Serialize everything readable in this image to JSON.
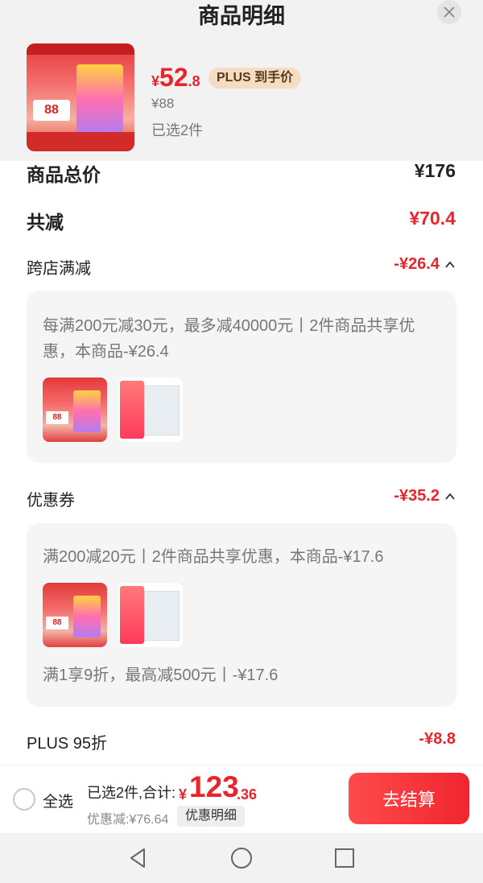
{
  "header": {
    "title": "商品明细"
  },
  "product": {
    "price_symbol": "¥",
    "price_int": "52",
    "price_dec": ".8",
    "plus_badge": "PLUS 到手价",
    "original_price": "¥88",
    "selected_count": "已选2件",
    "thumb_tag": "88"
  },
  "summary_rows": {
    "total_label": "商品总价",
    "total_value": "¥176",
    "reduce_label": "共减",
    "reduce_value": "¥70.4"
  },
  "sections": {
    "cross_store": {
      "label": "跨店满减",
      "value": "-¥26.4",
      "desc": "每满200元减30元，最多减40000元丨2件商品共享优惠，本商品-¥26.4"
    },
    "coupon": {
      "label": "优惠券",
      "value": "-¥35.2",
      "desc1": "满200减20元丨2件商品共享优惠，本商品-¥17.6",
      "desc2": "满1享9折，最高减500元丨-¥17.6"
    },
    "plus": {
      "label": "PLUS 95折",
      "value": "-¥8.8"
    }
  },
  "bottom_bar": {
    "select_all": "全选",
    "summary_text": "已选2件,合计:",
    "total_symbol": "¥",
    "total_int": "123",
    "total_dec": ".36",
    "discount_text": "优惠减:¥76.64",
    "detail_button": "优惠明细",
    "checkout_button": "去结算"
  },
  "colors": {
    "accent_red": "#e8242c",
    "plus_badge_bg": "#f5dcc3",
    "card_bg": "#f5f5f5"
  },
  "icons": [
    "close-icon",
    "chevron-up-icon",
    "back-icon",
    "home-icon",
    "recents-icon"
  ]
}
